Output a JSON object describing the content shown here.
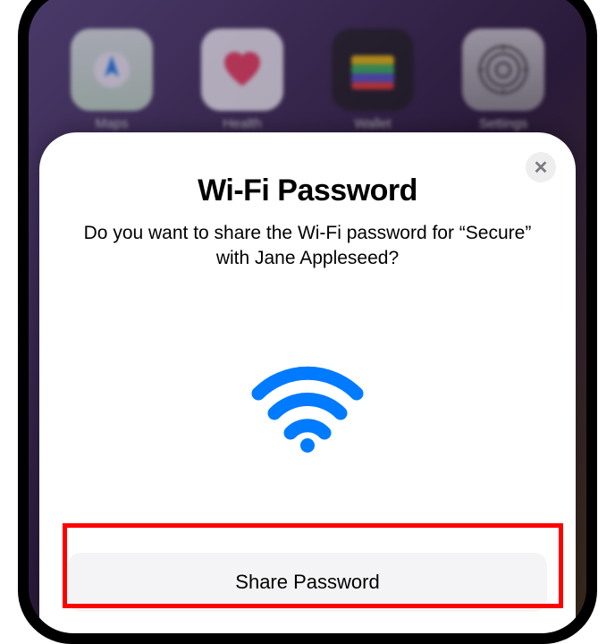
{
  "home_screen": {
    "apps": [
      {
        "name": "Maps",
        "icon": "maps"
      },
      {
        "name": "Health",
        "icon": "health"
      },
      {
        "name": "Wallet",
        "icon": "wallet"
      },
      {
        "name": "Settings",
        "icon": "settings"
      }
    ]
  },
  "modal": {
    "title": "Wi-Fi Password",
    "description": "Do you want to share the Wi-Fi password for “Secure” with Jane Appleseed?",
    "share_button_label": "Share Password",
    "close_label": "✕"
  }
}
